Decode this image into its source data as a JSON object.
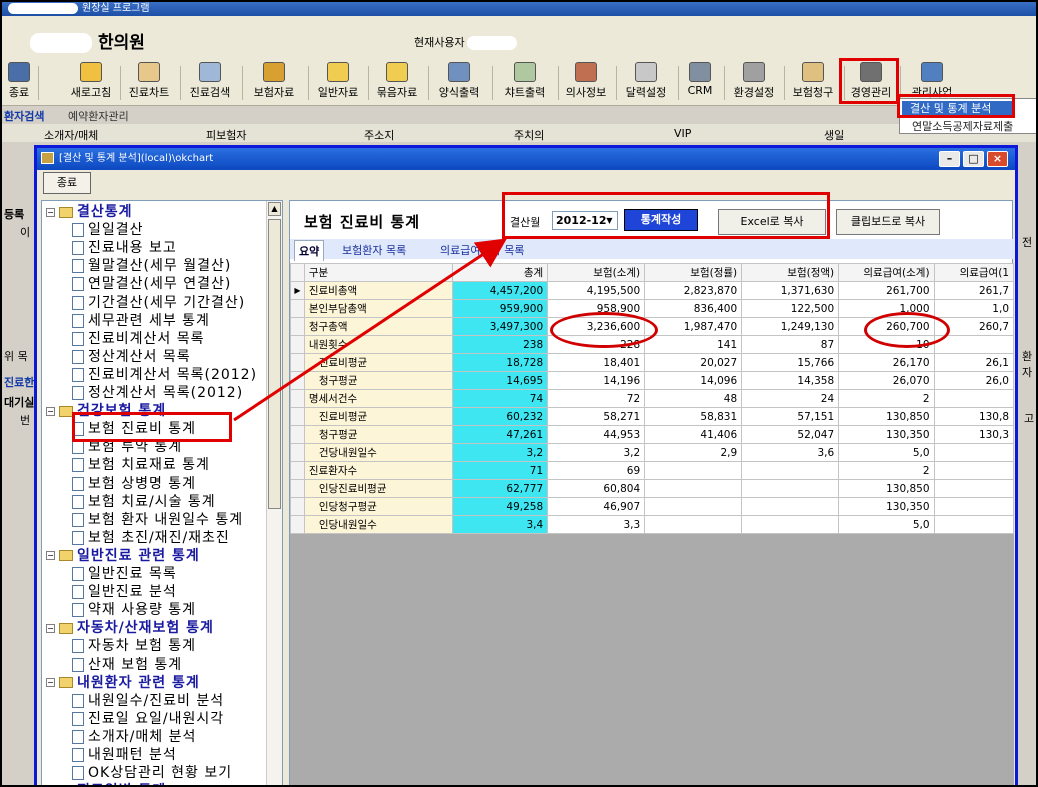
{
  "app": {
    "title": "원장실 프로그램",
    "clinic_name": "한의원",
    "current_user_label": "현재사용자"
  },
  "toolbar": [
    {
      "label": "종료",
      "icon": "monitor-icon"
    },
    {
      "label": "새로고침",
      "icon": "refresh-icon"
    },
    {
      "label": "진료차트",
      "icon": "chart-clipboard-icon"
    },
    {
      "label": "진료검색",
      "icon": "magnifier-icon"
    },
    {
      "label": "보험자료",
      "icon": "insurance-folder-icon"
    },
    {
      "label": "일반자료",
      "icon": "folder-icon"
    },
    {
      "label": "묶음자료",
      "icon": "folder-stack-icon"
    },
    {
      "label": "양식출력",
      "icon": "printer-icon"
    },
    {
      "label": "챠트출력",
      "icon": "chart-print-icon"
    },
    {
      "label": "의사정보",
      "icon": "doctor-icon"
    },
    {
      "label": "달력설정",
      "icon": "calendar-icon"
    },
    {
      "label": "CRM",
      "icon": "crm-icon"
    },
    {
      "label": "환경설정",
      "icon": "settings-icon"
    },
    {
      "label": "보험청구",
      "icon": "claim-pen-icon"
    },
    {
      "label": "경영관리",
      "icon": "management-icon"
    },
    {
      "label": "관리사업",
      "icon": "wand-icon"
    }
  ],
  "popup_menu": {
    "items": [
      "결산 및 통계 분석",
      "연말소득공제자료제출"
    ]
  },
  "main_tabs": [
    "환자검색",
    "예약환자관리"
  ],
  "main_columns": [
    "소개자/매체",
    "피보험자",
    "주소지",
    "주치의",
    "VIP",
    "생일"
  ],
  "left_stub": [
    "등록",
    "이",
    "위 목",
    "진료한",
    "대기실",
    "번"
  ],
  "right_stub": [
    "전",
    "환자",
    "고"
  ],
  "window": {
    "title": "[결산 및 통계 분석](local)\\okchart",
    "exit_label": "종료"
  },
  "tree": [
    {
      "label": "결산통계",
      "cat": true
    },
    {
      "label": "일일결산"
    },
    {
      "label": "진료내용 보고"
    },
    {
      "label": "월말결산(세무 월결산)"
    },
    {
      "label": "연말결산(세무 연결산)"
    },
    {
      "label": "기간결산(세무 기간결산)"
    },
    {
      "label": "세무관련 세부 통계"
    },
    {
      "label": "진료비계산서 목록"
    },
    {
      "label": "정산계산서 목록"
    },
    {
      "label": "진료비계산서 목록(2012)"
    },
    {
      "label": "정산계산서 목록(2012)"
    },
    {
      "label": "건강보험 통계",
      "cat": true
    },
    {
      "label": "보험 진료비 통계"
    },
    {
      "label": "보험 투약 통계"
    },
    {
      "label": "보험 치료재료 통계"
    },
    {
      "label": "보험 상병명 통계"
    },
    {
      "label": "보험 치료/시술 통계"
    },
    {
      "label": "보험 환자 내원일수 통계"
    },
    {
      "label": "보험 초진/재진/재초진"
    },
    {
      "label": "일반진료 관련 통계",
      "cat": true
    },
    {
      "label": "일반진료 목록"
    },
    {
      "label": "일반진료 분석"
    },
    {
      "label": "약재 사용량 통계"
    },
    {
      "label": "자동차/산재보험 통계",
      "cat": true
    },
    {
      "label": "자동차 보험 통계"
    },
    {
      "label": "산재 보험 통계"
    },
    {
      "label": "내원환자 관련 통계",
      "cat": true
    },
    {
      "label": "내원일수/진료비 분석"
    },
    {
      "label": "진료일 요일/내원시각"
    },
    {
      "label": "소개자/매체 분석"
    },
    {
      "label": "내원패턴 분석"
    },
    {
      "label": "OK상담관리 현황 보기"
    },
    {
      "label": "진료일별 통계",
      "cat": true
    }
  ],
  "panel": {
    "title": "보험 진료비 통계",
    "period_label": "결산월",
    "period_value": "2012-12",
    "generate_label": "통계작성",
    "excel_label": "Excel로 복사",
    "clipboard_label": "클립보드로 복사",
    "tabs": [
      "요약",
      "보험환자 목록",
      "의료급여환자 목록"
    ]
  },
  "table": {
    "columns": [
      "구분",
      "총계",
      "보험(소계)",
      "보험(정률)",
      "보험(정액)",
      "의료급여(소계)",
      "의료급여(1"
    ],
    "rows": [
      {
        "label": "진료비총액",
        "indent": false,
        "cells": [
          "4,457,200",
          "4,195,500",
          "2,823,870",
          "1,371,630",
          "261,700",
          "261,7"
        ]
      },
      {
        "label": "본인부담총액",
        "indent": false,
        "cells": [
          "959,900",
          "958,900",
          "836,400",
          "122,500",
          "1,000",
          "1,0"
        ]
      },
      {
        "label": "청구총액",
        "indent": false,
        "cells": [
          "3,497,300",
          "3,236,600",
          "1,987,470",
          "1,249,130",
          "260,700",
          "260,7"
        ]
      },
      {
        "label": "내원횟수",
        "indent": false,
        "cells": [
          "238",
          "228",
          "141",
          "87",
          "10",
          ""
        ]
      },
      {
        "label": "진료비평균",
        "indent": true,
        "cells": [
          "18,728",
          "18,401",
          "20,027",
          "15,766",
          "26,170",
          "26,1"
        ]
      },
      {
        "label": "청구평균",
        "indent": true,
        "cells": [
          "14,695",
          "14,196",
          "14,096",
          "14,358",
          "26,070",
          "26,0"
        ]
      },
      {
        "label": "명세서건수",
        "indent": false,
        "cells": [
          "74",
          "72",
          "48",
          "24",
          "2",
          ""
        ]
      },
      {
        "label": "진료비평균",
        "indent": true,
        "cells": [
          "60,232",
          "58,271",
          "58,831",
          "57,151",
          "130,850",
          "130,8"
        ]
      },
      {
        "label": "청구평균",
        "indent": true,
        "cells": [
          "47,261",
          "44,953",
          "41,406",
          "52,047",
          "130,350",
          "130,3"
        ]
      },
      {
        "label": "건당내원일수",
        "indent": true,
        "cells": [
          "3,2",
          "3,2",
          "2,9",
          "3,6",
          "5,0",
          ""
        ]
      },
      {
        "label": "진료환자수",
        "indent": false,
        "cells": [
          "71",
          "69",
          "",
          "",
          "2",
          ""
        ]
      },
      {
        "label": "인당진료비평균",
        "indent": true,
        "cells": [
          "62,777",
          "60,804",
          "",
          "",
          "130,850",
          ""
        ]
      },
      {
        "label": "인당청구평균",
        "indent": true,
        "cells": [
          "49,258",
          "46,907",
          "",
          "",
          "130,350",
          ""
        ]
      },
      {
        "label": "인당내원일수",
        "indent": true,
        "cells": [
          "3,4",
          "3,3",
          "",
          "",
          "5,0",
          ""
        ]
      }
    ]
  },
  "colors": {
    "highlight": "#e00000",
    "window_border": "#0d19d8",
    "total_column": "#3ee6f2",
    "generate_button": "#1f45d8"
  }
}
